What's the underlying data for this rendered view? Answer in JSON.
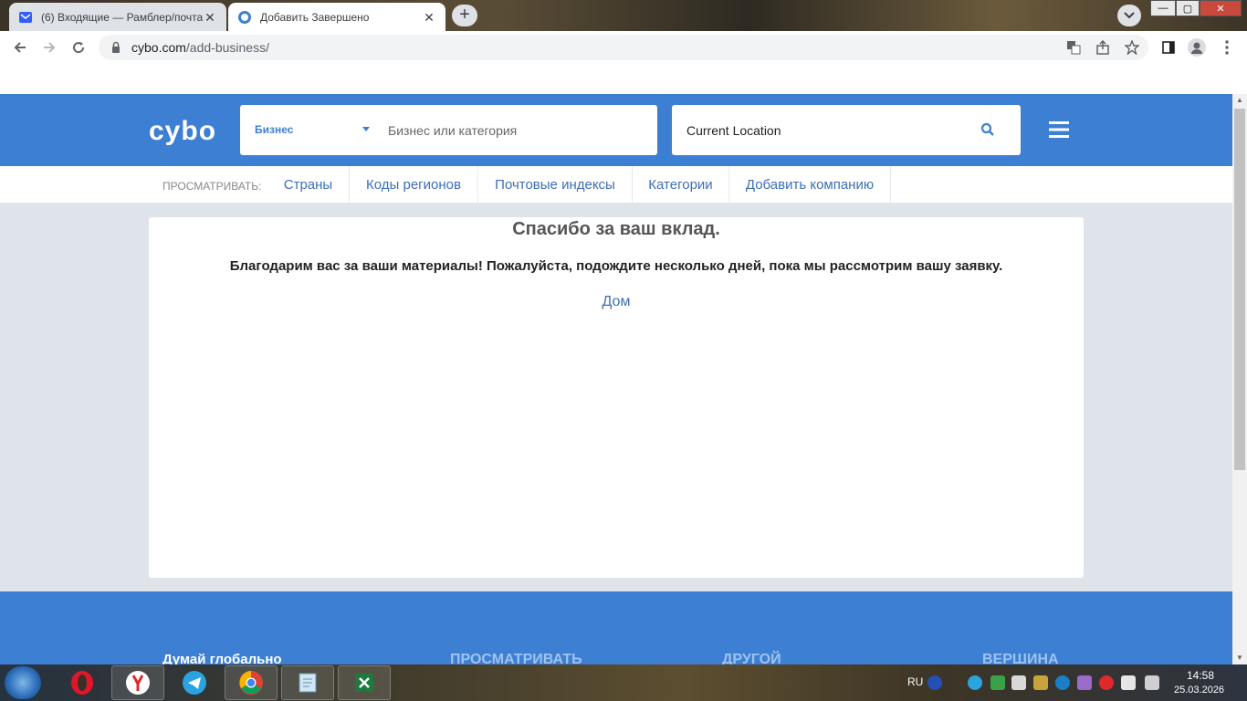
{
  "browser": {
    "tabs": [
      {
        "title": "(6) Входящие — Рамблер/почта"
      },
      {
        "title": "Добавить Завершено"
      }
    ],
    "url_host": "cybo.com",
    "url_path": "/add-business/"
  },
  "header": {
    "logo": "cybo",
    "category_label": "Бизнес",
    "search_placeholder": "Бизнес или категория",
    "location_value": "Current Location"
  },
  "browse": {
    "label": "ПРОСМАТРИВАТЬ:",
    "links": [
      "Страны",
      "Коды регионов",
      "Почтовые индексы",
      "Категории",
      "Добавить компанию"
    ]
  },
  "main": {
    "title": "Спасибо за ваш вклад.",
    "message": "Благодарим вас за ваши материалы! Пожалуйста, подождите несколько дней, пока мы рассмотрим вашу заявку.",
    "home_link": "Дом"
  },
  "footer": {
    "columns": [
      "Думай глобально",
      "ПРОСМАТРИВАТЬ",
      "ДРУГОЙ",
      "ВЕРШИНА"
    ]
  },
  "taskbar": {
    "lang": "RU",
    "time": "14:58",
    "date": "25.03.2026"
  },
  "colors": {
    "brand_blue": "#3d7fd3",
    "link_blue": "#3d6fb6",
    "page_bg": "#dfe3ea"
  }
}
